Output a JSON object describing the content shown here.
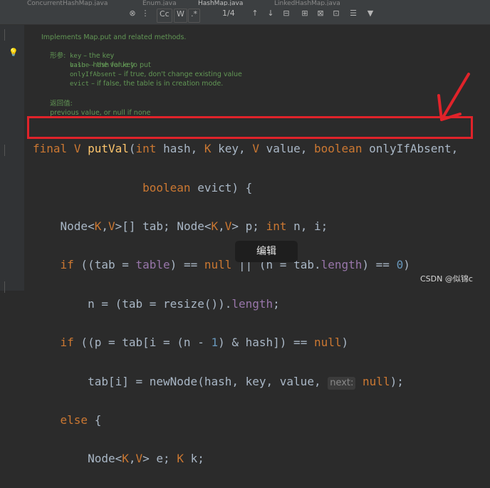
{
  "tabs": [
    "ConcurrentHashMap.java",
    "Enum.java",
    "HashMap.java",
    "LinkedHashMap.java"
  ],
  "toolbar": {
    "match_case": "Cc",
    "words": "W",
    "regex": ".*",
    "match_count": "1/4"
  },
  "javadoc": {
    "summary": "Implements Map.put and related methods.",
    "params_label": "形参:",
    "params": [
      {
        "name": "hash",
        "desc": " – hash for key"
      },
      {
        "name": "key",
        "desc": " – the key"
      },
      {
        "name": "value",
        "desc": " – the value to put"
      },
      {
        "name": "onlyIfAbsent",
        "desc": " – if true, don't change existing value"
      },
      {
        "name": "evict",
        "desc": " – if false, the table is in creation mode."
      }
    ],
    "returns_label": "返回值:",
    "returns_text": "previous value, or null if none"
  },
  "code": {
    "l1": {
      "final": "final",
      "V": "V",
      "fn": "putVal",
      "p1": "(",
      "int": "int",
      "hash": " hash, ",
      "K": "K",
      "key": " key, ",
      "V2": "V",
      "value": " value, ",
      "boolean": "boolean",
      "only": " onlyIfAbsent,"
    },
    "l2": {
      "boolean": "boolean",
      "rest": " evict) {"
    },
    "l3": {
      "a": "Node<",
      "K": "K",
      "c": ",",
      "V": "V",
      "d": ">[] tab; Node<",
      "K2": "K",
      "e": ",",
      "V2": "V",
      "f": "> p; ",
      "int": "int",
      "g": " n, i;"
    },
    "l4": {
      "if": "if",
      "a": " ((tab = ",
      "table": "table",
      "b": ") == ",
      "null": "null",
      "c": " || (n = tab.",
      "length": "length",
      "d": ") == ",
      "zero": "0",
      "e": ")"
    },
    "l5": {
      "a": "n = (tab = resize()).",
      "length": "length",
      "b": ";"
    },
    "l6": {
      "if": "if",
      "a": " ((p = tab[i = (n - ",
      "one": "1",
      "b": ") & hash]) == ",
      "null": "null",
      "c": ")"
    },
    "l7": {
      "a": "tab[i] = newNode(hash, key, value, ",
      "hint": "next:",
      "null": " null",
      "b": ");"
    },
    "l8": {
      "else": "else",
      "a": " {"
    },
    "l9": {
      "a": "Node<",
      "K": "K",
      "c": ",",
      "V": "V",
      "d": "> e; ",
      "K2": "K",
      "e": " k;"
    }
  },
  "overlay": {
    "edit_label": "编辑",
    "watermark": "CSDN @似锦c"
  },
  "colors": {
    "highlight_box": "#e0232a",
    "keyword": "#cc7832",
    "method": "#ffc66d",
    "field": "#9876aa",
    "number": "#6897bb",
    "doc": "#629755"
  }
}
